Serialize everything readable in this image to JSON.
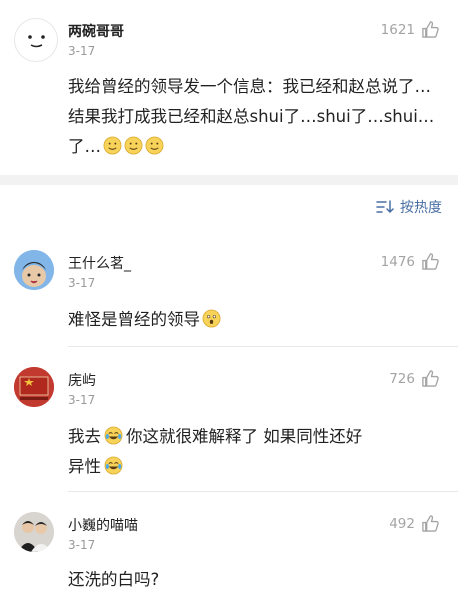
{
  "first_comment": {
    "username": "两碗哥哥",
    "date": "3-17",
    "likes": "1621",
    "text": "我给曾经的领导发一个信息：我已经和赵总说了…结果我打成我已经和赵总shui了…shui了…shui…了…"
  },
  "sort": {
    "label": "按热度",
    "icon": "sort-icon"
  },
  "comments": [
    {
      "username": "王什么茗_",
      "date": "3-17",
      "likes": "1476",
      "text": "难怪是曾经的领导"
    },
    {
      "username": "庑屿",
      "date": "3-17",
      "likes": "726",
      "text": "我去",
      "text2": "你这就很难解释了  如果同性还好",
      "text3": "异性"
    },
    {
      "username": "小巍的喵喵",
      "date": "3-17",
      "likes": "492",
      "text": "还洗的白吗?"
    }
  ],
  "colors": {
    "link_blue": "#4a6fa5",
    "muted": "#9a9a9a",
    "separator": "#f2f2f2"
  }
}
